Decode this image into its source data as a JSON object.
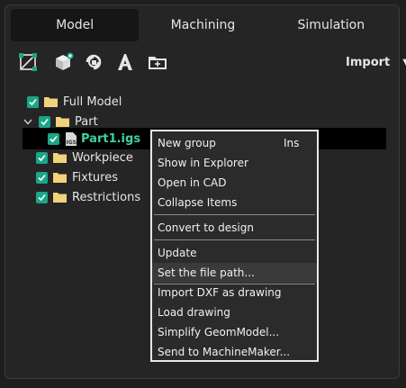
{
  "tabs": [
    {
      "label": "Model"
    },
    {
      "label": "Machining"
    },
    {
      "label": "Simulation"
    }
  ],
  "toolbar": {
    "icons": [
      "sketch-icon",
      "add-solid-icon",
      "refresh-model-icon",
      "text-icon",
      "new-folder-icon"
    ],
    "import_label": "Import"
  },
  "tree": {
    "full_model": "Full Model",
    "part": "Part",
    "part_file": "Part1.igs",
    "workpiece": "Workpiece",
    "fixtures": "Fixtures",
    "restrictions": "Restrictions"
  },
  "context_menu": {
    "new_group": "New group",
    "new_group_shortcut": "Ins",
    "show_in_explorer": "Show in Explorer",
    "open_in_cad": "Open in CAD",
    "collapse_items": "Collapse Items",
    "convert_to_design": "Convert to design",
    "update": "Update",
    "set_file_path": "Set the file path...",
    "import_dxf": "Import DXF as drawing",
    "load_drawing": "Load drawing",
    "simplify": "Simplify GeomModel...",
    "send_to_machinemaker": "Send to MachineMaker..."
  },
  "colors": {
    "accent_green": "#19a689",
    "folder_yellow": "#f2d27a",
    "selected_text": "#3fd39a"
  }
}
